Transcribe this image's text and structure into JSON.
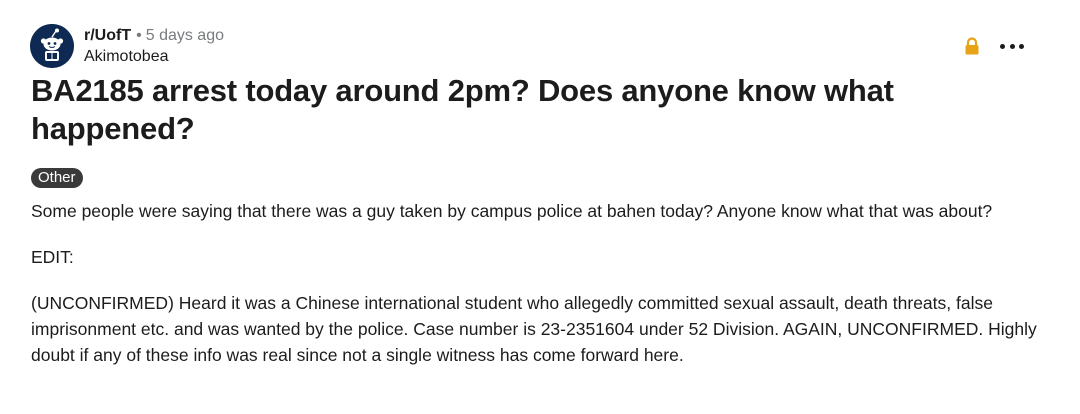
{
  "post": {
    "subreddit": "r/UofT",
    "separator": "•",
    "time_ago": "5 days ago",
    "author": "Akimotobea",
    "title": "BA2185 arrest today around 2pm? Does anyone know what happened?",
    "flair": "Other",
    "body": {
      "paragraph_1": "Some people were saying that there was a guy taken by campus police at bahen today? Anyone know what that was about?",
      "paragraph_2": "EDIT:",
      "paragraph_3": "(UNCONFIRMED) Heard it was a Chinese international student who allegedly committed sexual assault, death threats, false imprisonment etc. and was wanted by the police. Case number is 23-2351604 under 52 Division. AGAIN, UNCONFIRMED. Highly doubt if any of these info was real since not a single witness has come forward here."
    }
  },
  "icons": {
    "avatar": "subreddit-avatar-icon",
    "lock": "lock-icon",
    "more": "more-options-icon"
  },
  "colors": {
    "avatar_bg": "#0e2a52",
    "lock": "#e6a316",
    "flair_bg": "#3a3a3a",
    "muted_text": "#787c7e",
    "text": "#1c1c1c"
  }
}
